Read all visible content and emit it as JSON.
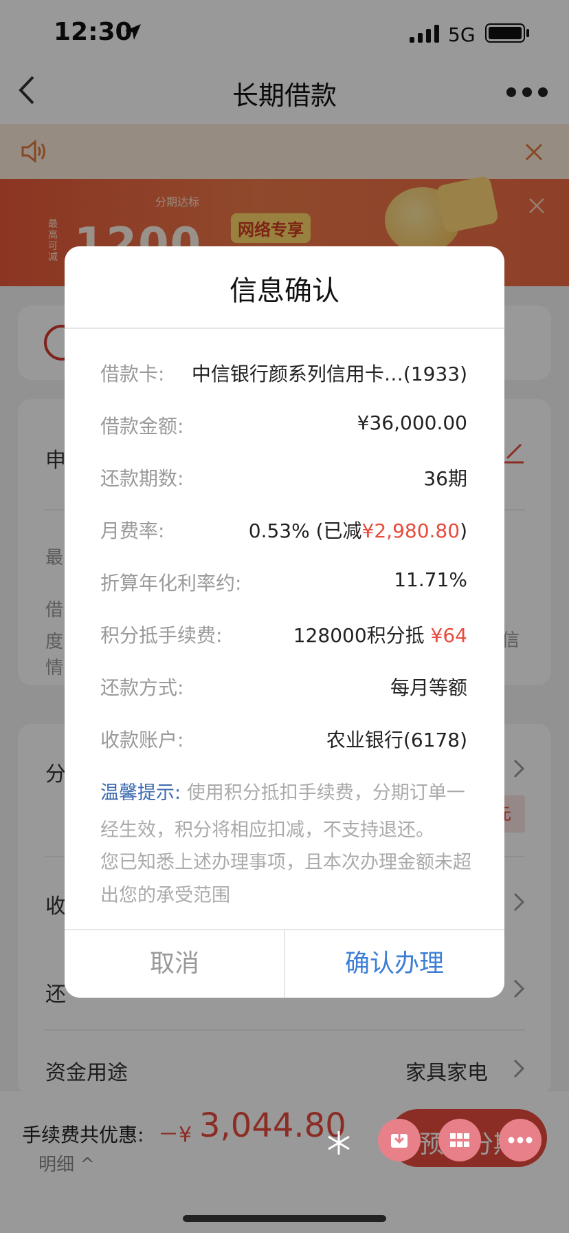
{
  "status_bar": {
    "time": "12:30",
    "network": "5G"
  },
  "nav": {
    "title": "长期借款"
  },
  "banner": {
    "subtitle": "分期达标",
    "side_text": "最高可减",
    "number": "1200",
    "tag": "网络专享"
  },
  "background": {
    "card_title_fragment": "申",
    "text_fragment_1": "最",
    "text_fragment_2": "借",
    "text_fragment_3": "度",
    "text_fragment_4": "情",
    "right_fragment": "信",
    "row_1_fragment": "分",
    "row_2_fragment": "收",
    "row_3_fragment": "还",
    "row_purpose_label": "资金用途",
    "row_purpose_value": "家具家电",
    "badge_fragment": "元"
  },
  "bottom_bar": {
    "label": "手续费共优惠:",
    "minus": "－¥",
    "amount": "3,044.80",
    "detail": "明细 ^",
    "button": "预约分期"
  },
  "modal": {
    "title": "信息确认",
    "rows": [
      {
        "label": "借款卡:",
        "value": "中信银行颜系列信用卡…(1933)"
      },
      {
        "label": "借款金额:",
        "value": "¥36,000.00"
      },
      {
        "label": "还款期数:",
        "value": "36期"
      },
      {
        "label": "月费率:",
        "value_prefix": "0.53% (已减",
        "value_highlight": "¥2,980.80",
        "value_suffix": ")"
      },
      {
        "label": "折算年化利率约:",
        "value": "11.71%"
      },
      {
        "label": "积分抵手续费:",
        "value_prefix": "128000积分抵 ",
        "value_highlight": "¥64"
      },
      {
        "label": "还款方式:",
        "value": "每月等额"
      },
      {
        "label": "收款账户:",
        "value": "农业银行(6178)"
      }
    ],
    "tip_label": "温馨提示:",
    "tip_text": " 使用积分抵扣手续费，分期订单一经生效，积分将相应扣减，不支持退还。",
    "notice": "您已知悉上述办理事项，且本次办理金额未超出您的承受范围",
    "cancel": "取消",
    "confirm": "确认办理"
  }
}
